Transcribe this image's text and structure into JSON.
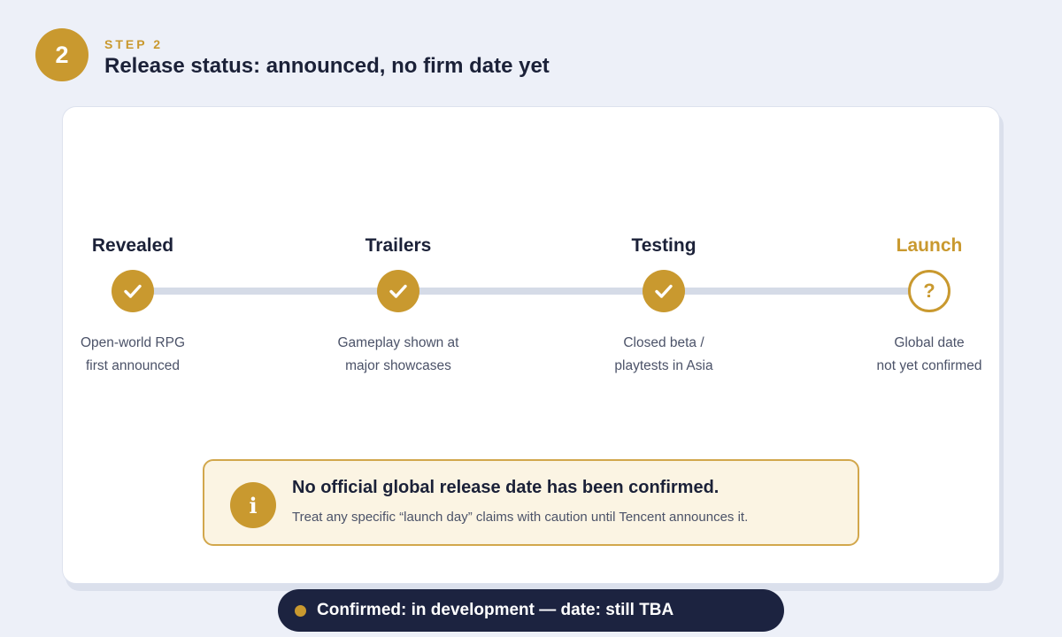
{
  "header": {
    "step_number": "2",
    "step_label": "STEP 2",
    "title": "Release status: announced, no firm date yet"
  },
  "timeline": {
    "milestones": [
      {
        "title": "Revealed",
        "status": "done",
        "icon": "check-icon",
        "desc_line1": "Open-world RPG",
        "desc_line2": "first announced"
      },
      {
        "title": "Trailers",
        "status": "done",
        "icon": "check-icon",
        "desc_line1": "Gameplay shown at",
        "desc_line2": "major showcases"
      },
      {
        "title": "Testing",
        "status": "done",
        "icon": "check-icon",
        "desc_line1": "Closed beta /",
        "desc_line2": "playtests in Asia"
      },
      {
        "title": "Launch",
        "status": "pending",
        "icon": "question-icon",
        "icon_glyph": "?",
        "desc_line1": "Global date",
        "desc_line2": "not yet confirmed"
      }
    ]
  },
  "notice": {
    "icon": "info-icon",
    "icon_glyph": "i",
    "title": "No official global release date has been confirmed.",
    "body": "Treat any specific “launch day” claims with caution until Tencent announces it."
  },
  "status": {
    "text": "Confirmed: in development — date: still TBA"
  },
  "colors": {
    "accent_gold": "#c9992f",
    "navy": "#1c2340",
    "background": "#edf0f8",
    "notice_bg": "#fbf4e3"
  }
}
